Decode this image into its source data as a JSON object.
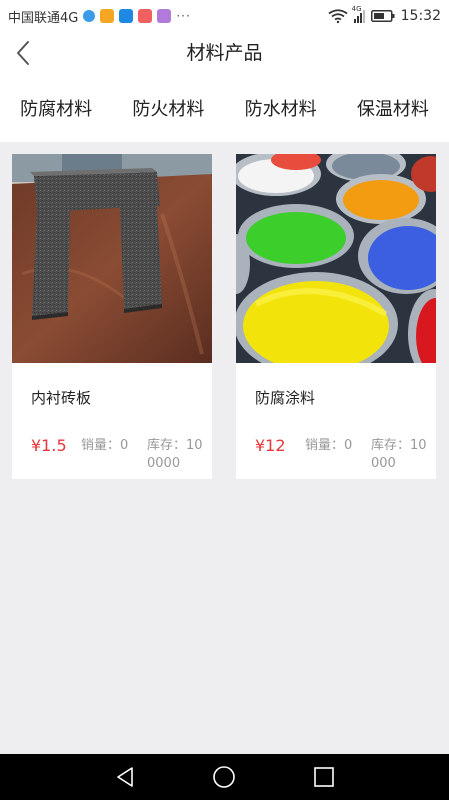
{
  "status_bar": {
    "carrier": "中国联通4G",
    "more": "···",
    "network": "4G",
    "time": "15:32",
    "app_icon_colors": [
      "#3a9be8",
      "#f5a623",
      "#1e88e5",
      "#f06060",
      "#b27ad8"
    ]
  },
  "header": {
    "title": "材料产品"
  },
  "tabs": [
    {
      "label": "防腐材料"
    },
    {
      "label": "防火材料"
    },
    {
      "label": "防水材料"
    },
    {
      "label": "保温材料"
    }
  ],
  "products": [
    {
      "name": "内衬砖板",
      "price": "¥1.5",
      "sales": "销量：0",
      "stock": "库存：100000",
      "image": "foam-brick-photo"
    },
    {
      "name": "防腐涂料",
      "price": "¥12",
      "sales": "销量：0",
      "stock": "库存：10000",
      "image": "paint-cans-photo"
    }
  ],
  "colors": {
    "price": "#e8363c",
    "background": "#eeedf0",
    "card": "#ffffff"
  }
}
